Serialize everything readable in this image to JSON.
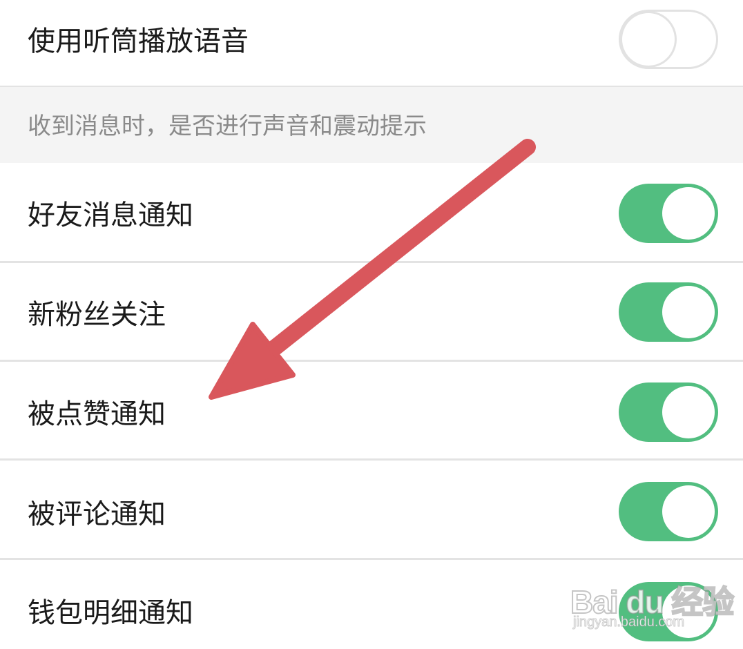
{
  "settings": {
    "earpiece_row": {
      "label": "使用听筒播放语音",
      "enabled": false
    },
    "section_header": "收到消息时，是否进行声音和震动提示",
    "notification_rows": [
      {
        "label": "好友消息通知",
        "enabled": true
      },
      {
        "label": "新粉丝关注",
        "enabled": true
      },
      {
        "label": "被点赞通知",
        "enabled": true
      },
      {
        "label": "被评论通知",
        "enabled": true
      },
      {
        "label": "钱包明细通知",
        "enabled": true
      }
    ]
  },
  "colors": {
    "toggle_on": "#52be80",
    "toggle_off_border": "#e2e2e2",
    "arrow": "#d9575c",
    "section_bg": "#f4f4f4"
  },
  "annotation": {
    "icon": "red-arrow-icon"
  },
  "watermark": {
    "logo": "Bai du 经验",
    "url": "jingyan.baidu.com"
  }
}
